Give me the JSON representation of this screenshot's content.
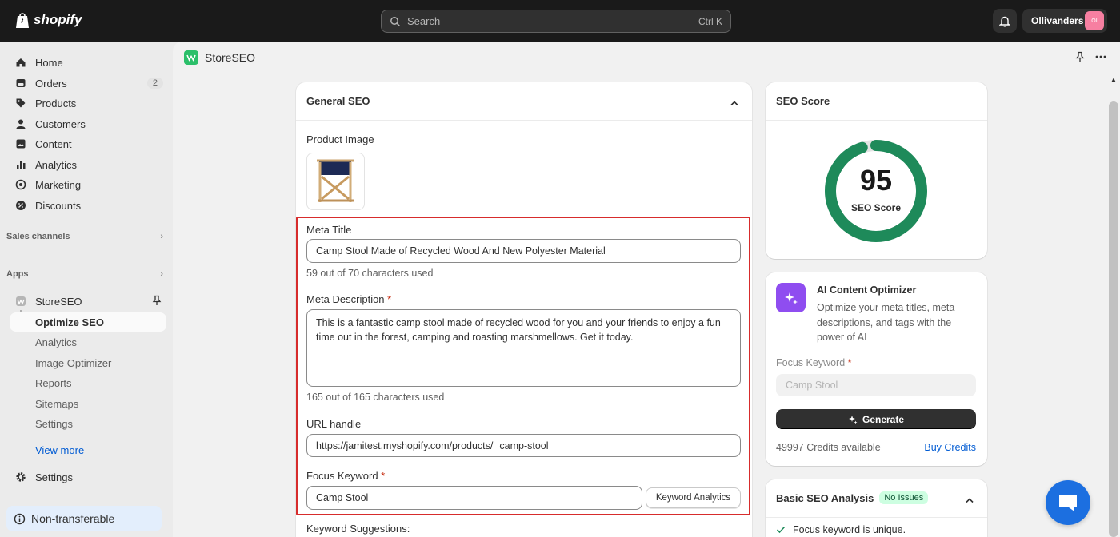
{
  "topbar": {
    "brand": "shopify",
    "search_placeholder": "Search",
    "search_shortcut": "Ctrl K",
    "store_name": "Ollivanders",
    "store_initials": "OI"
  },
  "sidebar": {
    "items": [
      {
        "label": "Home",
        "icon": "home-icon"
      },
      {
        "label": "Orders",
        "icon": "orders-icon",
        "badge": "2"
      },
      {
        "label": "Products",
        "icon": "tag-icon"
      },
      {
        "label": "Customers",
        "icon": "person-icon"
      },
      {
        "label": "Content",
        "icon": "content-icon"
      },
      {
        "label": "Analytics",
        "icon": "bar-chart-icon"
      },
      {
        "label": "Marketing",
        "icon": "target-icon"
      },
      {
        "label": "Discounts",
        "icon": "discount-icon"
      }
    ],
    "sales_channels": "Sales channels",
    "apps": "Apps",
    "app_name": "StoreSEO",
    "app_subitems": [
      "Optimize SEO",
      "Analytics",
      "Image Optimizer",
      "Reports",
      "Sitemaps",
      "Settings"
    ],
    "view_more": "View more",
    "settings": "Settings",
    "non_transferable": "Non-transferable"
  },
  "main": {
    "app_title": "StoreSEO"
  },
  "general_seo": {
    "title": "General SEO",
    "product_image_label": "Product Image",
    "meta_title_label": "Meta Title",
    "meta_title_value": "Camp Stool Made of Recycled Wood And New Polyester Material",
    "meta_title_help": "59 out of 70 characters used",
    "meta_desc_label": "Meta Description",
    "meta_desc_value": "This is a fantastic camp stool made of recycled wood for you and your friends to enjoy a fun time out in the forest, camping and roasting marshmellows. Get it today.",
    "meta_desc_help": "165 out of 165 characters used",
    "url_label": "URL handle",
    "url_prefix": "https://jamitest.myshopify.com/products/",
    "url_value": "camp-stool",
    "focus_label": "Focus Keyword",
    "focus_value": "Camp Stool",
    "keyword_analytics": "Keyword Analytics",
    "keyword_suggestions": "Keyword Suggestions:",
    "required_mark": "*"
  },
  "seo_score": {
    "title": "SEO Score",
    "score": "95",
    "score_value": 95,
    "score_label": "SEO Score",
    "ring_color": "#1e8a5a"
  },
  "ai_optimizer": {
    "title": "AI Content Optimizer",
    "description": "Optimize your meta titles, meta descriptions, and tags with the power of AI",
    "focus_label": "Focus Keyword",
    "focus_placeholder": "Camp Stool",
    "generate": "Generate",
    "credits": "49997 Credits available",
    "buy_credits": "Buy Credits",
    "required_mark": "*"
  },
  "basic_analysis": {
    "title": "Basic SEO Analysis",
    "badge": "No Issues",
    "item1": "Focus keyword is unique."
  }
}
